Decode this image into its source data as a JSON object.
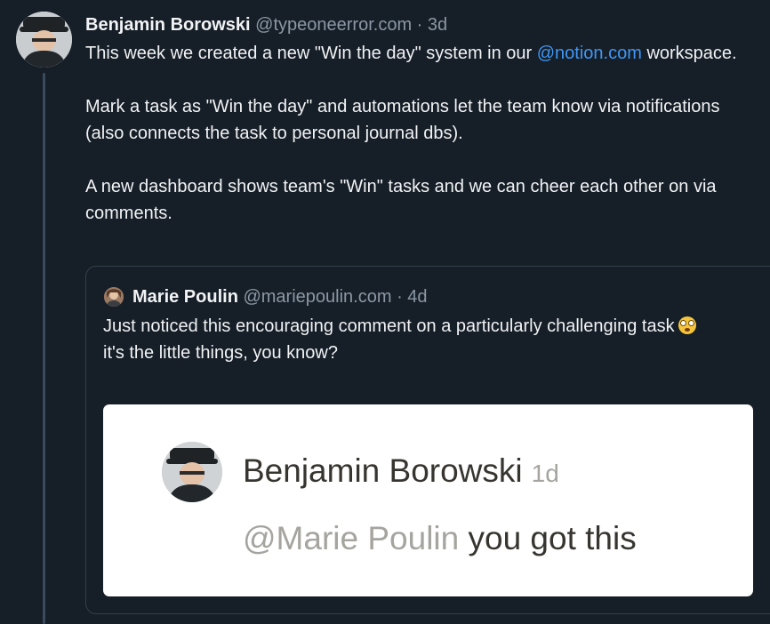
{
  "post": {
    "author_name": "Benjamin Borowski",
    "author_handle": "@typeoneerror.com",
    "separator": "·",
    "time": "3d",
    "body": {
      "p1_text": "This week we created a new \"Win the day\" system in our ",
      "p1_mention": "@notion.com",
      "p1_end": " workspace.",
      "p2": "Mark a task as \"Win the day\" and automations let the team know via notifications (also connects the task to personal journal dbs).",
      "p3": "A new dashboard shows team's \"Win\" tasks and we can cheer each other on via comments."
    }
  },
  "quote": {
    "author_name": "Marie Poulin",
    "author_handle": "@mariepoulin.com",
    "separator": "·",
    "time": "4d",
    "line1": "Just noticed this encouraging comment on a particularly challenging task",
    "line1_emoji": "flushed-face-emoji",
    "line2": "it's the little things, you know?",
    "image": {
      "name": "Benjamin Borowski",
      "time": "1d",
      "mention": "@Marie Poulin",
      "comment": " you got this"
    }
  },
  "colors": {
    "background": "#161e27",
    "text": "#f1f3f5",
    "muted": "#8b98a5",
    "link": "#3f97f5",
    "border": "#34404d",
    "thread_line": "#3b4b5e"
  }
}
